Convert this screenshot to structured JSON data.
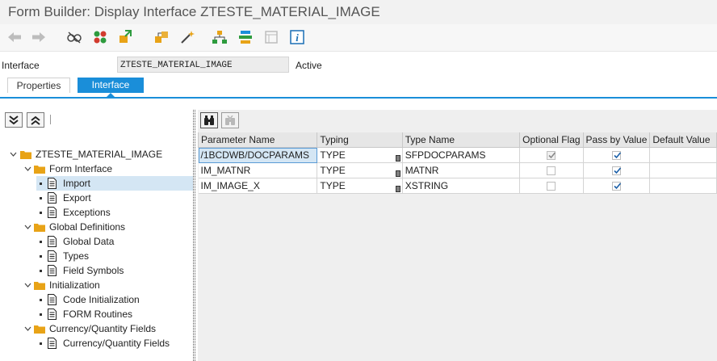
{
  "window": {
    "title": "Form Builder: Display Interface ZTESTE_MATERIAL_IMAGE"
  },
  "toolbar": {
    "icons": [
      "back-arrow-icon",
      "forward-arrow-icon",
      "display-change-icon",
      "check-icon",
      "activate-icon",
      "where-used-icon",
      "magic-wand-icon",
      "hierarchy-icon",
      "layout-icon",
      "form-disabled-icon",
      "info-icon"
    ]
  },
  "header": {
    "interface_label": "Interface",
    "interface_value": "ZTESTE_MATERIAL_IMAGE",
    "status": "Active"
  },
  "tabs": [
    {
      "label": "Properties",
      "active": false
    },
    {
      "label": "Interface",
      "active": true
    }
  ],
  "tree": {
    "root": "ZTESTE_MATERIAL_IMAGE",
    "form_interface": "Form Interface",
    "import": "Import",
    "export": "Export",
    "exceptions": "Exceptions",
    "global_definitions": "Global Definitions",
    "global_data": "Global Data",
    "types": "Types",
    "field_symbols": "Field Symbols",
    "initialization": "Initialization",
    "code_initialization": "Code Initialization",
    "form_routines": "FORM Routines",
    "currency_quantity": "Currency/Quantity Fields",
    "currency_quantity_child": "Currency/Quantity Fields"
  },
  "table": {
    "columns": [
      "Parameter Name",
      "Typing",
      "Type Name",
      "Optional Flag",
      "Pass by Value",
      "Default Value"
    ],
    "rows": [
      {
        "param": "/1BCDWB/DOCPARAMS",
        "typing": "TYPE",
        "type_name": "SFPDOCPARAMS",
        "optional": true,
        "pass_by_value": true,
        "default": ""
      },
      {
        "param": "IM_MATNR",
        "typing": "TYPE",
        "type_name": "MATNR",
        "optional": false,
        "pass_by_value": true,
        "default": ""
      },
      {
        "param": "IM_IMAGE_X",
        "typing": "TYPE",
        "type_name": "XSTRING",
        "optional": false,
        "pass_by_value": true,
        "default": ""
      }
    ]
  },
  "colors": {
    "accent": "#1a8ed9",
    "selection": "#d4e6f4",
    "folder": "#e8a317"
  }
}
